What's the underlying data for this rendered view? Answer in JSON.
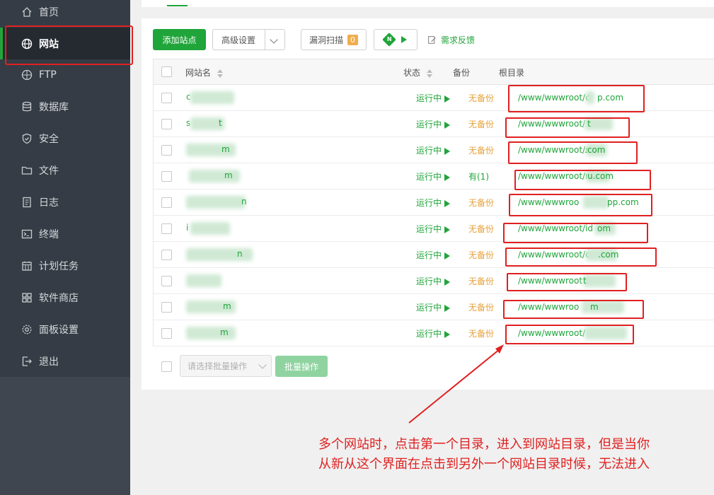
{
  "sidebar": {
    "items": [
      {
        "label": "首页",
        "icon": "home-icon"
      },
      {
        "label": "网站",
        "icon": "globe-icon",
        "active": true
      },
      {
        "label": "FTP",
        "icon": "ftp-icon"
      },
      {
        "label": "数据库",
        "icon": "database-icon"
      },
      {
        "label": "安全",
        "icon": "shield-icon"
      },
      {
        "label": "文件",
        "icon": "folder-icon"
      },
      {
        "label": "日志",
        "icon": "log-icon"
      },
      {
        "label": "终端",
        "icon": "terminal-icon"
      },
      {
        "label": "计划任务",
        "icon": "calendar-icon"
      },
      {
        "label": "软件商店",
        "icon": "apps-icon"
      },
      {
        "label": "面板设置",
        "icon": "gear-icon"
      },
      {
        "label": "退出",
        "icon": "logout-icon"
      }
    ]
  },
  "toolbar": {
    "add_site": "添加站点",
    "advanced": "高级设置",
    "vuln_scan": "漏洞扫描",
    "vuln_count": "0",
    "nginx_badge": "N",
    "feedback": "需求反馈"
  },
  "table": {
    "headers": {
      "name": "网站名",
      "status": "状态",
      "backup": "备份",
      "root": "根目录"
    },
    "rows": [
      {
        "name": "c",
        "status": "运行中",
        "backup": "无备份",
        "path": "/www/wwwroot/c",
        "path_tail": "p.com"
      },
      {
        "name": "s",
        "name_tail": "t",
        "status": "运行中",
        "backup": "无备份",
        "path": "/www/wwwroot/",
        "path_tail": "t"
      },
      {
        "name": "",
        "name_tail": "m",
        "status": "运行中",
        "backup": "无备份",
        "path": "/www/wwwroot/s",
        "path_tail": ".com"
      },
      {
        "name": "",
        "name_tail": "m",
        "status": "运行中",
        "backup": "有(1)",
        "path": "/www/wwwroot/r",
        "path_tail": "u.com"
      },
      {
        "name": "",
        "name_tail": "n",
        "status": "运行中",
        "backup": "无备份",
        "path": "/www/wwwroo",
        "path_tail": "pp.com"
      },
      {
        "name": "i",
        "status": "运行中",
        "backup": "无备份",
        "path": "/www/wwwroot/id",
        "path_tail": "om"
      },
      {
        "name": "",
        "name_tail": "n",
        "status": "运行中",
        "backup": "无备份",
        "path": "/www/wwwroot/c",
        "path_tail": ".com"
      },
      {
        "name": "",
        "status": "运行中",
        "backup": "无备份",
        "path": "/www/wwwroot",
        "path_tail": "t"
      },
      {
        "name": "",
        "name_tail": "m",
        "status": "运行中",
        "backup": "无备份",
        "path": "/www/wwwroo",
        "path_tail": "m"
      },
      {
        "name": "",
        "name_tail": "m",
        "status": "运行中",
        "backup": "无备份",
        "path": "/www/wwwroot/",
        "path_tail": ""
      }
    ]
  },
  "bulk": {
    "select_placeholder": "请选择批量操作",
    "run": "批量操作"
  },
  "annotation": {
    "line1": "多个网站时，点击第一个目录，进入到网站目录，但是当你",
    "line2": "从新从这个界面在点击到另外一个网站目录时候，无法进入"
  },
  "colors": {
    "accent": "#20a53a",
    "warning": "#e6a23c",
    "annotation": "#e02020",
    "sidebar": "#353c45"
  }
}
